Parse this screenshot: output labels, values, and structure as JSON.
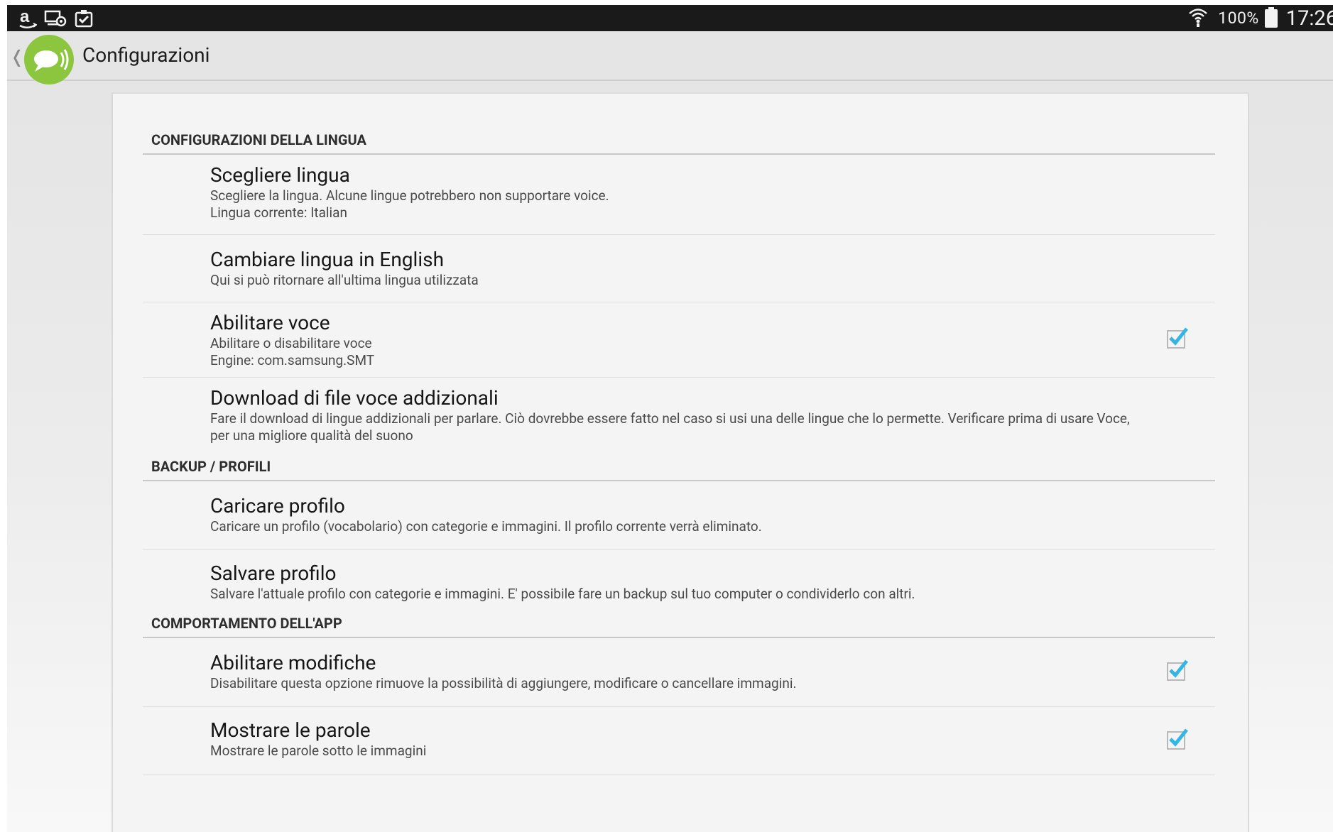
{
  "status_bar": {
    "icons_left": [
      "amazon-icon",
      "screen-cast-icon",
      "clipboard-check-icon"
    ],
    "icons_right": [
      "wifi-icon",
      "battery-icon"
    ],
    "battery_percent": "100%",
    "clock": "17:26"
  },
  "action_bar": {
    "title": "Configurazioni"
  },
  "sections": [
    {
      "header": "CONFIGURAZIONI DELLA LINGUA",
      "items": [
        {
          "title": "Scegliere lingua",
          "summary": "Scegliere la lingua. Alcune lingue potrebbero non supportare voice.",
          "summary2": "Lingua corrente: Italian"
        },
        {
          "title": "Cambiare lingua in English",
          "summary": "Qui si può ritornare all'ultima lingua utilizzata"
        },
        {
          "title": "Abilitare voce",
          "summary": "Abilitare o disabilitare voce",
          "summary2": "Engine: com.samsung.SMT",
          "checked": true
        },
        {
          "title": "Download di file voce addizionali",
          "summary": "Fare il download di lingue addizionali per parlare. Ciò dovrebbe essere fatto nel caso si usi una delle lingue che lo permette. Verificare prima di usare Voce,",
          "summary2": "per una migliore qualità del suono"
        }
      ]
    },
    {
      "header": "BACKUP / PROFILI",
      "items": [
        {
          "title": "Caricare profilo",
          "summary": "Caricare un profilo (vocabolario) con categorie e immagini. Il profilo corrente verrà eliminato."
        },
        {
          "title": "Salvare profilo",
          "summary": "Salvare l'attuale profilo con categorie e immagini. E' possibile fare un backup sul tuo computer o condividerlo con altri."
        }
      ]
    },
    {
      "header": "COMPORTAMENTO DELL'APP",
      "items": [
        {
          "title": "Abilitare modifiche",
          "summary": "Disabilitare questa opzione rimuove la possibilità di aggiungere, modificare o cancellare immagini.",
          "checked": true
        },
        {
          "title": "Mostrare le parole",
          "summary": "Mostrare le parole sotto le immagini",
          "checked": true
        }
      ]
    }
  ],
  "colors": {
    "accent": "#33b5e5",
    "logo_green": "#8cc63f",
    "status_bar": "#1a1a1a"
  }
}
